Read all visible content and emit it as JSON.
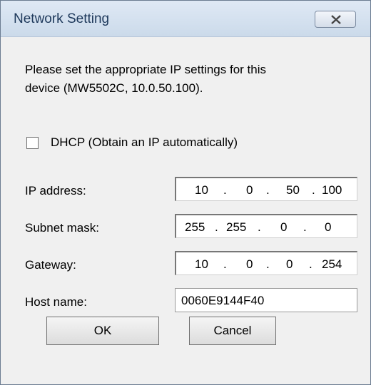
{
  "dialog": {
    "title": "Network Setting",
    "message_line1": "Please set the appropriate IP settings for this",
    "message_line2": "device (MW5502C, 10.0.50.100).",
    "dhcp": {
      "label": "DHCP (Obtain an IP automatically)",
      "checked": false
    },
    "fields": {
      "ip_address": {
        "label": "IP address:",
        "octets": [
          "10",
          "0",
          "50",
          "100"
        ]
      },
      "subnet_mask": {
        "label": "Subnet mask:",
        "octets": [
          "255",
          "255",
          "0",
          "0"
        ]
      },
      "gateway": {
        "label": "Gateway:",
        "octets": [
          "10",
          "0",
          "0",
          "254"
        ]
      },
      "host_name": {
        "label": "Host name:",
        "value": "0060E9144F40"
      }
    },
    "buttons": {
      "ok": "OK",
      "cancel": "Cancel"
    },
    "ip_separator": "."
  },
  "icons": {
    "close": "close-icon"
  }
}
